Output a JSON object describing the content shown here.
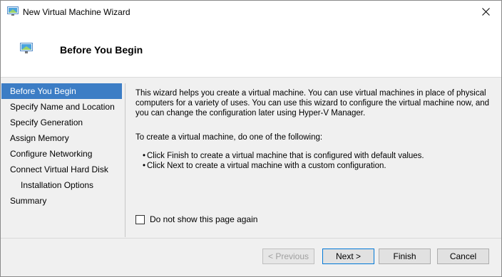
{
  "window": {
    "title": "New Virtual Machine Wizard",
    "close_label": "✕"
  },
  "header": {
    "title": "Before You Begin"
  },
  "nav": {
    "items": [
      {
        "label": "Before You Begin",
        "active": true,
        "sub": false
      },
      {
        "label": "Specify Name and Location",
        "active": false,
        "sub": false
      },
      {
        "label": "Specify Generation",
        "active": false,
        "sub": false
      },
      {
        "label": "Assign Memory",
        "active": false,
        "sub": false
      },
      {
        "label": "Configure Networking",
        "active": false,
        "sub": false
      },
      {
        "label": "Connect Virtual Hard Disk",
        "active": false,
        "sub": false
      },
      {
        "label": "Installation Options",
        "active": false,
        "sub": true
      },
      {
        "label": "Summary",
        "active": false,
        "sub": false
      }
    ]
  },
  "content": {
    "intro": "This wizard helps you create a virtual machine. You can use virtual machines in place of physical computers for a variety of uses. You can use this wizard to configure the virtual machine now, and you can change the configuration later using Hyper-V Manager.",
    "instruction": "To create a virtual machine, do one of the following:",
    "bullets": [
      "Click Finish to create a virtual machine that is configured with default values.",
      "Click Next to create a virtual machine with a custom configuration."
    ],
    "bullet_glyph": "•"
  },
  "checkbox": {
    "label": "Do not show this page again",
    "checked": false
  },
  "buttons": {
    "previous": "< Previous",
    "next": "Next >",
    "finish": "Finish",
    "cancel": "Cancel"
  },
  "colors": {
    "accent": "#3c7dc5",
    "default_button_border": "#0078d7"
  }
}
